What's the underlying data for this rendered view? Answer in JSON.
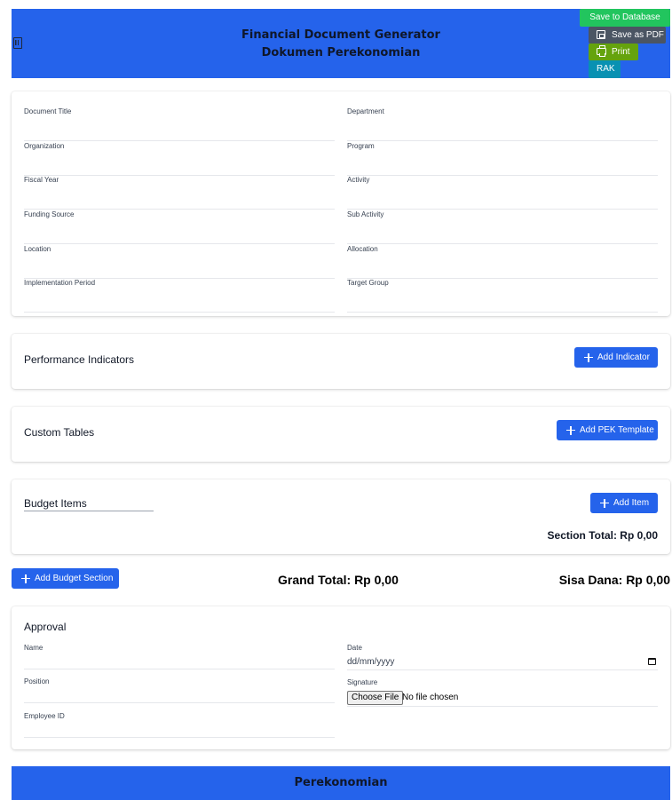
{
  "header": {
    "icon": "building-icon",
    "title_line1": "Financial Document Generator",
    "title_line2": "Dokumen Perekonomian",
    "bg_color": "#2563eb"
  },
  "toolbar": {
    "save_db_label": "Save to Database",
    "save_pdf_label": "Save as PDF",
    "print_label": "Print",
    "rak_label": "RAK",
    "colors": {
      "save_db": "#22c55e",
      "save_pdf": "#4b5563",
      "print": "#65a30d",
      "rak": "#0891b2"
    }
  },
  "info": {
    "left": [
      {
        "label": "Document Title",
        "value": ""
      },
      {
        "label": "Organization",
        "value": ""
      },
      {
        "label": "Fiscal Year",
        "value": ""
      },
      {
        "label": "Funding Source",
        "value": ""
      },
      {
        "label": "Location",
        "value": ""
      },
      {
        "label": "Implementation Period",
        "value": ""
      }
    ],
    "right": [
      {
        "label": "Department",
        "value": ""
      },
      {
        "label": "Program",
        "value": ""
      },
      {
        "label": "Activity",
        "value": ""
      },
      {
        "label": "Sub Activity",
        "value": ""
      },
      {
        "label": "Allocation",
        "value": ""
      },
      {
        "label": "Target Group",
        "value": ""
      }
    ]
  },
  "performance": {
    "title": "Performance Indicators",
    "add_label": "Add Indicator"
  },
  "custom_tables": {
    "title": "Custom Tables",
    "add_label": "Add PEK Template"
  },
  "budget": {
    "section_name": "Budget Items",
    "add_item_label": "Add Item",
    "section_total": "Section Total: Rp 0,00"
  },
  "totals": {
    "add_section_label": "Add Budget Section",
    "grand_total": "Grand Total: Rp 0,00",
    "sisa_dana": "Sisa Dana: Rp 0,00"
  },
  "approval": {
    "title": "Approval",
    "name_label": "Name",
    "position_label": "Position",
    "employee_id_label": "Employee ID",
    "date_label": "Date",
    "date_placeholder": "dd/mm/yyyy",
    "signature_label": "Signature",
    "choose_file_label": "Choose File",
    "no_file_text": "No file chosen"
  },
  "footer": {
    "text": "Perekonomian"
  }
}
